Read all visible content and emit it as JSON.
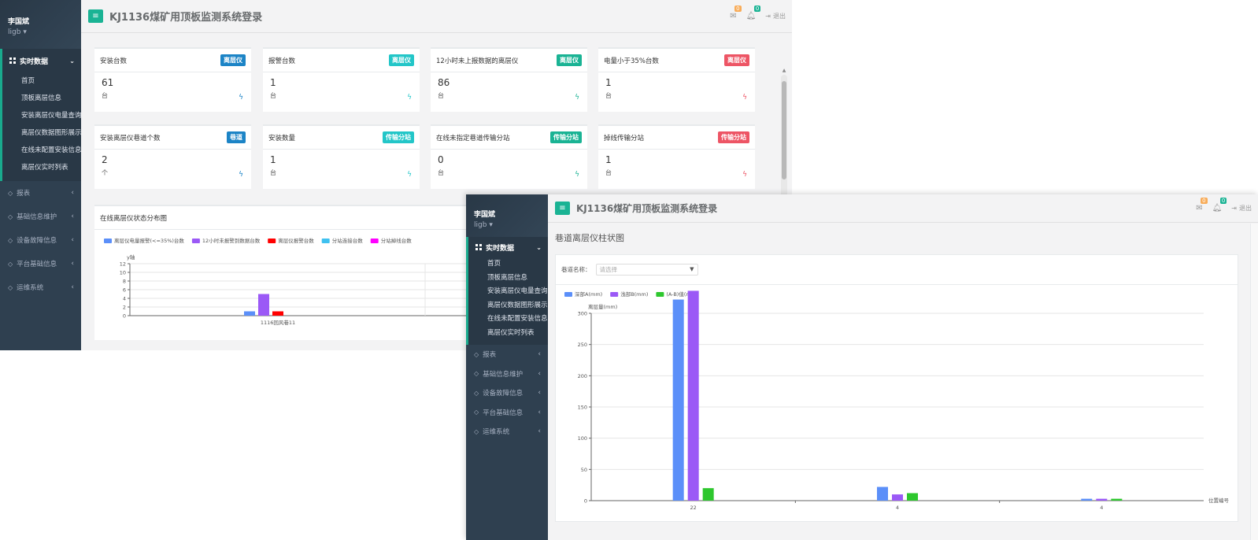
{
  "app": {
    "title": "KJ1136煤矿用顶板监测系统登录",
    "user_name": "李国斌",
    "account": "ligb",
    "logout": "退出",
    "notif_mail_count": "0",
    "notif_bell_count": "0"
  },
  "sidebar": {
    "group_label": "实时数据",
    "sub_items": [
      "首页",
      "顶板离层信息",
      "安装离层仪电量查询",
      "离层仪数据图形展示",
      "在线未配置安装信息",
      "离层仪实时列表"
    ],
    "items": [
      "报表",
      "基础信息维护",
      "设备故障信息",
      "平台基础信息",
      "运维系统"
    ]
  },
  "widgets": [
    {
      "title": "安装台数",
      "label": "离层仪",
      "value": "61",
      "unit": "台",
      "style": "success"
    },
    {
      "title": "报警台数",
      "label": "离层仪",
      "value": "1",
      "unit": "台",
      "style": "info"
    },
    {
      "title": "12小时未上报数据的离层仪",
      "label": "离层仪",
      "value": "86",
      "unit": "台",
      "style": "primary"
    },
    {
      "title": "电量小于35%台数",
      "label": "离层仪",
      "value": "1",
      "unit": "台",
      "style": "danger"
    },
    {
      "title": "安装离层仪巷道个数",
      "label": "巷道",
      "value": "2",
      "unit": "个",
      "style": "success"
    },
    {
      "title": "安装数量",
      "label": "传输分站",
      "value": "1",
      "unit": "台",
      "style": "info"
    },
    {
      "title": "在线未指定巷道传输分站",
      "label": "传输分站",
      "value": "0",
      "unit": "台",
      "style": "primary"
    },
    {
      "title": "掉线传输分站",
      "label": "传输分站",
      "value": "1",
      "unit": "台",
      "style": "danger"
    }
  ],
  "status_chart": {
    "title": "在线离层仪状态分布图"
  },
  "bar_panel": {
    "title": "巷道离层仪柱状图",
    "filter_label": "巷道名称：",
    "filter_placeholder": "请选择"
  },
  "colors": {
    "primary": "#1ab394",
    "sidebar_bg": "#2f4050",
    "success": "#1c84c6",
    "info": "#23c6c8",
    "danger": "#ed5565",
    "warning": "#f8ac59"
  },
  "chart_data": [
    {
      "type": "bar",
      "title": "在线离层仪状态分布图",
      "categories": [
        "1116回风巷11"
      ],
      "ylabel": "y轴",
      "ylim": [
        0,
        12
      ],
      "yticks": [
        0,
        2,
        4,
        6,
        8,
        10,
        12
      ],
      "grid": true,
      "legend_position": "top-left",
      "series": [
        {
          "name": "离层仪电量报警(<=35%)台数",
          "values": [
            1
          ],
          "color": "#5b8ff9"
        },
        {
          "name": "12小时未报警到数据台数",
          "values": [
            5
          ],
          "color": "#9b59f6"
        },
        {
          "name": "离层仪报警台数",
          "values": [
            1
          ],
          "color": "#ff0000"
        },
        {
          "name": "分站连接台数",
          "values": [
            0
          ],
          "color": "#3fc1f0"
        },
        {
          "name": "分站掉线台数",
          "values": [
            0
          ],
          "color": "#ff00ff"
        }
      ]
    },
    {
      "type": "bar",
      "title": "巷道离层仪柱状图",
      "categories": [
        "22",
        "4",
        "4"
      ],
      "xlabel": "位置编号",
      "ylabel": "离层量(mm)",
      "ylim": [
        0,
        300
      ],
      "yticks": [
        0,
        50,
        100,
        150,
        200,
        250,
        300
      ],
      "grid": true,
      "legend_position": "top-left",
      "series": [
        {
          "name": "深部A(mm)",
          "values": [
            322,
            22,
            3
          ],
          "color": "#5b8ff9"
        },
        {
          "name": "浅部B(mm)",
          "values": [
            336,
            10,
            3
          ],
          "color": "#9b59f6"
        },
        {
          "name": "(A-B)值(mm)",
          "values": [
            20,
            12,
            3
          ],
          "color": "#2ec72e"
        }
      ]
    }
  ]
}
